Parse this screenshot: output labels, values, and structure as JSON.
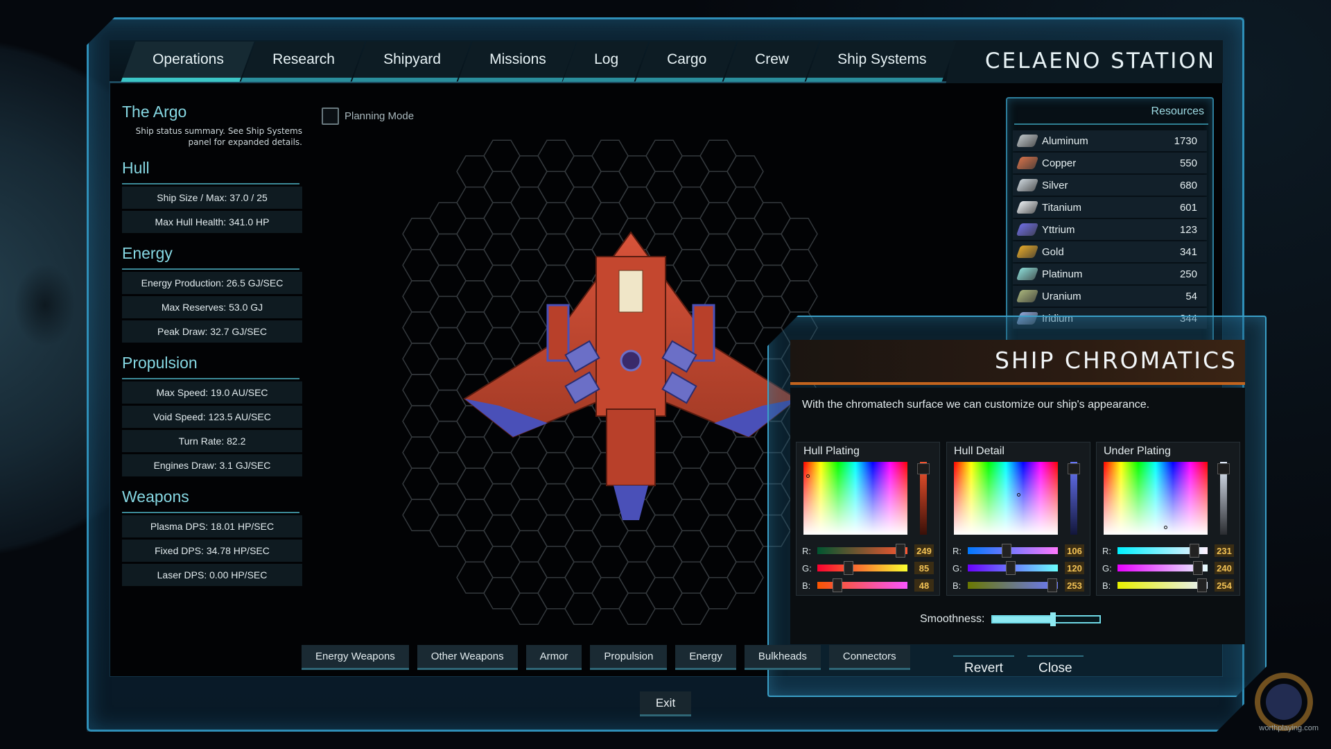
{
  "station": {
    "title": "CELAENO STATION"
  },
  "nav": {
    "tabs": [
      {
        "label": "Operations"
      },
      {
        "label": "Research"
      },
      {
        "label": "Shipyard"
      },
      {
        "label": "Missions"
      },
      {
        "label": "Log"
      },
      {
        "label": "Cargo"
      },
      {
        "label": "Crew"
      },
      {
        "label": "Ship Systems"
      }
    ]
  },
  "ship": {
    "name": "The Argo",
    "description": "Ship status summary. See Ship Systems panel for expanded details.",
    "sections": {
      "hull": {
        "title": "Hull",
        "stats": [
          "Ship Size / Max: 37.0 / 25",
          "Max Hull Health: 341.0 HP"
        ]
      },
      "energy": {
        "title": "Energy",
        "stats": [
          "Energy Production: 26.5 GJ/SEC",
          "Max Reserves: 53.0 GJ",
          "Peak Draw: 32.7 GJ/SEC"
        ]
      },
      "propulsion": {
        "title": "Propulsion",
        "stats": [
          "Max Speed: 19.0 AU/SEC",
          "Void Speed: 123.5 AU/SEC",
          "Turn Rate: 82.2",
          "Engines Draw: 3.1 GJ/SEC"
        ]
      },
      "weapons": {
        "title": "Weapons",
        "stats": [
          "Plasma DPS: 18.01 HP/SEC",
          "Fixed DPS: 34.78 HP/SEC",
          "Laser DPS: 0.00 HP/SEC"
        ]
      }
    }
  },
  "planning": {
    "label": "Planning Mode",
    "checked": false
  },
  "resources": {
    "title": "Resources",
    "items": [
      {
        "name": "Aluminum",
        "value": "1730",
        "icon": "aluminum-icon",
        "color": "#b9c0c3"
      },
      {
        "name": "Copper",
        "value": "550",
        "icon": "copper-icon",
        "color": "#d0704a"
      },
      {
        "name": "Silver",
        "value": "680",
        "icon": "silver-icon",
        "color": "#c9d2d8"
      },
      {
        "name": "Titanium",
        "value": "601",
        "icon": "titanium-icon",
        "color": "#e8ecef"
      },
      {
        "name": "Yttrium",
        "value": "123",
        "icon": "yttrium-icon",
        "color": "#6d6de0"
      },
      {
        "name": "Gold",
        "value": "341",
        "icon": "gold-icon",
        "color": "#e0a62a"
      },
      {
        "name": "Platinum",
        "value": "250",
        "icon": "platinum-icon",
        "color": "#8ad8d3"
      },
      {
        "name": "Uranium",
        "value": "54",
        "icon": "uranium-icon",
        "color": "#a7b27a"
      },
      {
        "name": "Iridium",
        "value": "344",
        "icon": "iridium-icon",
        "color": "#8fa6d8"
      }
    ]
  },
  "chromatics": {
    "title": "SHIP CHROMATICS",
    "description": "With the chromatech surface we can customize our ship's appearance.",
    "pickers": [
      {
        "title": "Hull Plating",
        "r": "249",
        "g": "85",
        "b": "48",
        "rf": 0.97,
        "gf": 0.33,
        "bf": 0.19
      },
      {
        "title": "Hull Detail",
        "r": "106",
        "g": "120",
        "b": "253",
        "rf": 0.42,
        "gf": 0.47,
        "bf": 0.99
      },
      {
        "title": "Under Plating",
        "r": "231",
        "g": "240",
        "b": "254",
        "rf": 0.9,
        "gf": 0.94,
        "bf": 0.99
      }
    ],
    "channel_labels": {
      "r": "R:",
      "g": "G:",
      "b": "B:"
    },
    "smoothness": {
      "label": "Smoothness:",
      "level": 0.55
    },
    "revert": "Revert",
    "close": "Close"
  },
  "categories": [
    "Energy Weapons",
    "Other Weapons",
    "Armor",
    "Propulsion",
    "Energy",
    "Bulkheads",
    "Connectors"
  ],
  "exit": "Exit",
  "watermark": {
    "text": "worthplaying.com"
  }
}
